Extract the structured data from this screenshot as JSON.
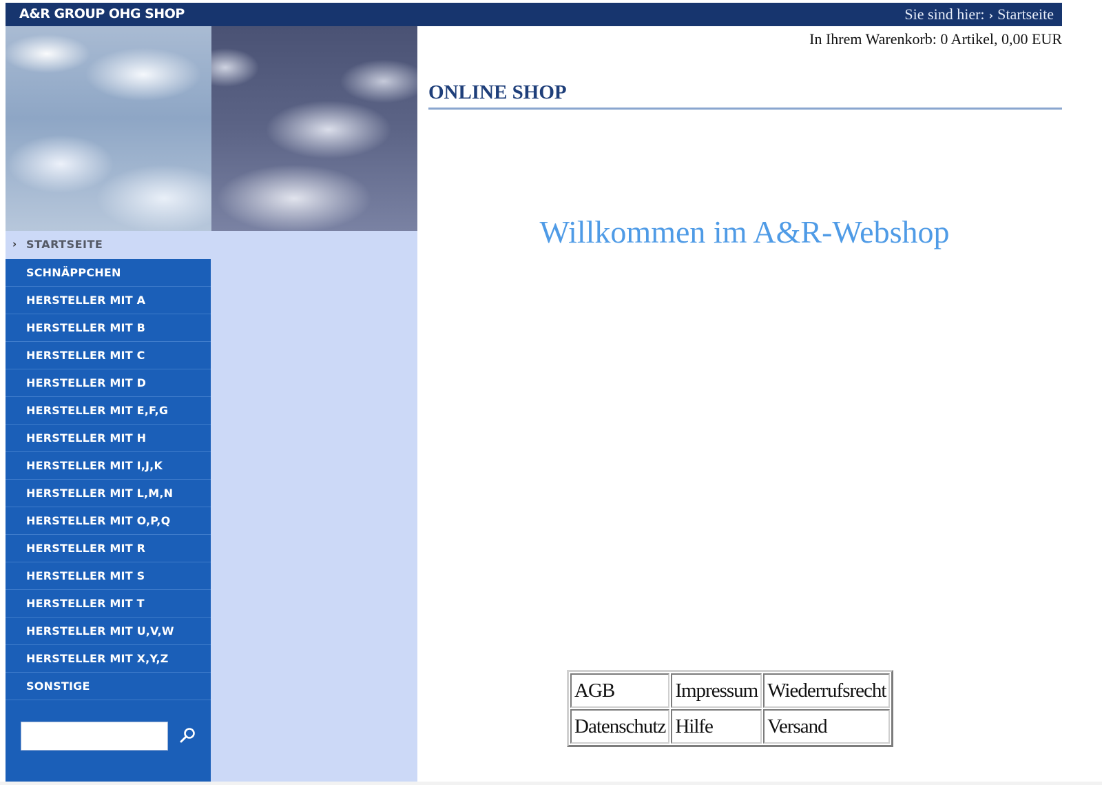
{
  "header": {
    "shop_name": "A&R GROUP OHG SHOP",
    "breadcrumb_prefix": "Sie sind hier:",
    "breadcrumb_current": "Startseite"
  },
  "cart": {
    "text": "In Ihrem Warenkorb: 0 Artikel, 0,00 EUR"
  },
  "sidebar": {
    "startseite": "STARTSEITE",
    "items": [
      "SCHNÄPPCHEN",
      "HERSTELLER MIT A",
      "HERSTELLER MIT B",
      "HERSTELLER MIT C",
      "HERSTELLER MIT D",
      "HERSTELLER MIT E,F,G",
      "HERSTELLER MIT H",
      "HERSTELLER MIT I,J,K",
      "HERSTELLER MIT L,M,N",
      "HERSTELLER MIT O,P,Q",
      "HERSTELLER MIT R",
      "HERSTELLER MIT S",
      "HERSTELLER MIT T",
      "HERSTELLER MIT U,V,W",
      "HERSTELLER MIT X,Y,Z",
      "SONSTIGE"
    ],
    "search": {
      "value": "",
      "icon": "search-icon"
    }
  },
  "main": {
    "title": "ONLINE SHOP",
    "welcome": "Willkommen im A&R-Webshop"
  },
  "footer": {
    "rows": [
      [
        "AGB",
        "Impressum",
        "Wiederrufsrecht"
      ],
      [
        "Datenschutz",
        "Hilfe",
        "Versand"
      ]
    ]
  },
  "colors": {
    "topbar": "#17356e",
    "nav": "#1b5fb8",
    "sidebar_bg": "#ccd9f7",
    "welcome": "#4f9be6",
    "title": "#1f3f7a"
  }
}
